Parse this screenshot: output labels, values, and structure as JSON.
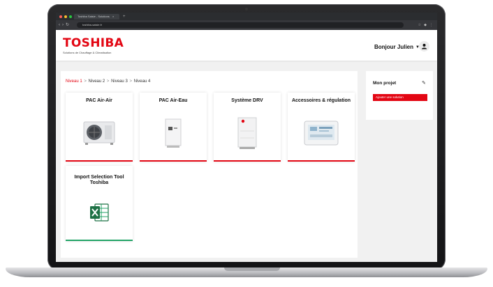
{
  "browser": {
    "tab_title": "Toshiba Saisie - Solutions",
    "tab_close": "×",
    "new_tab": "+",
    "url": "toshiba-saisie.fr",
    "nav_back": "‹",
    "nav_forward": "›",
    "nav_reload": "↻"
  },
  "header": {
    "logo": "TOSHIBA",
    "tagline": "Solutions de Chauffage & Climatisation",
    "greeting": "Bonjour Julien",
    "accent_color": "#e30613"
  },
  "breadcrumb": {
    "items": [
      "Niveau 1",
      "Niveau 2",
      "Niveau 3",
      "Niveau 4"
    ],
    "separator": ">"
  },
  "products": [
    {
      "title": "PAC Air-Air",
      "icon": "outdoor-unit",
      "bar_color": "#e30613"
    },
    {
      "title": "PAC Air-Eau",
      "icon": "hydro-unit",
      "bar_color": "#e30613"
    },
    {
      "title": "Système DRV",
      "icon": "vrf-unit",
      "bar_color": "#e30613"
    },
    {
      "title": "Accessoires & régulation",
      "icon": "controller",
      "bar_color": "#e30613"
    },
    {
      "title": "Import Selection Tool Toshiba",
      "icon": "excel-icon",
      "bar_color": "#21a366"
    }
  ],
  "project": {
    "title": "Mon projet",
    "add_button": "Ajouter une solution"
  }
}
